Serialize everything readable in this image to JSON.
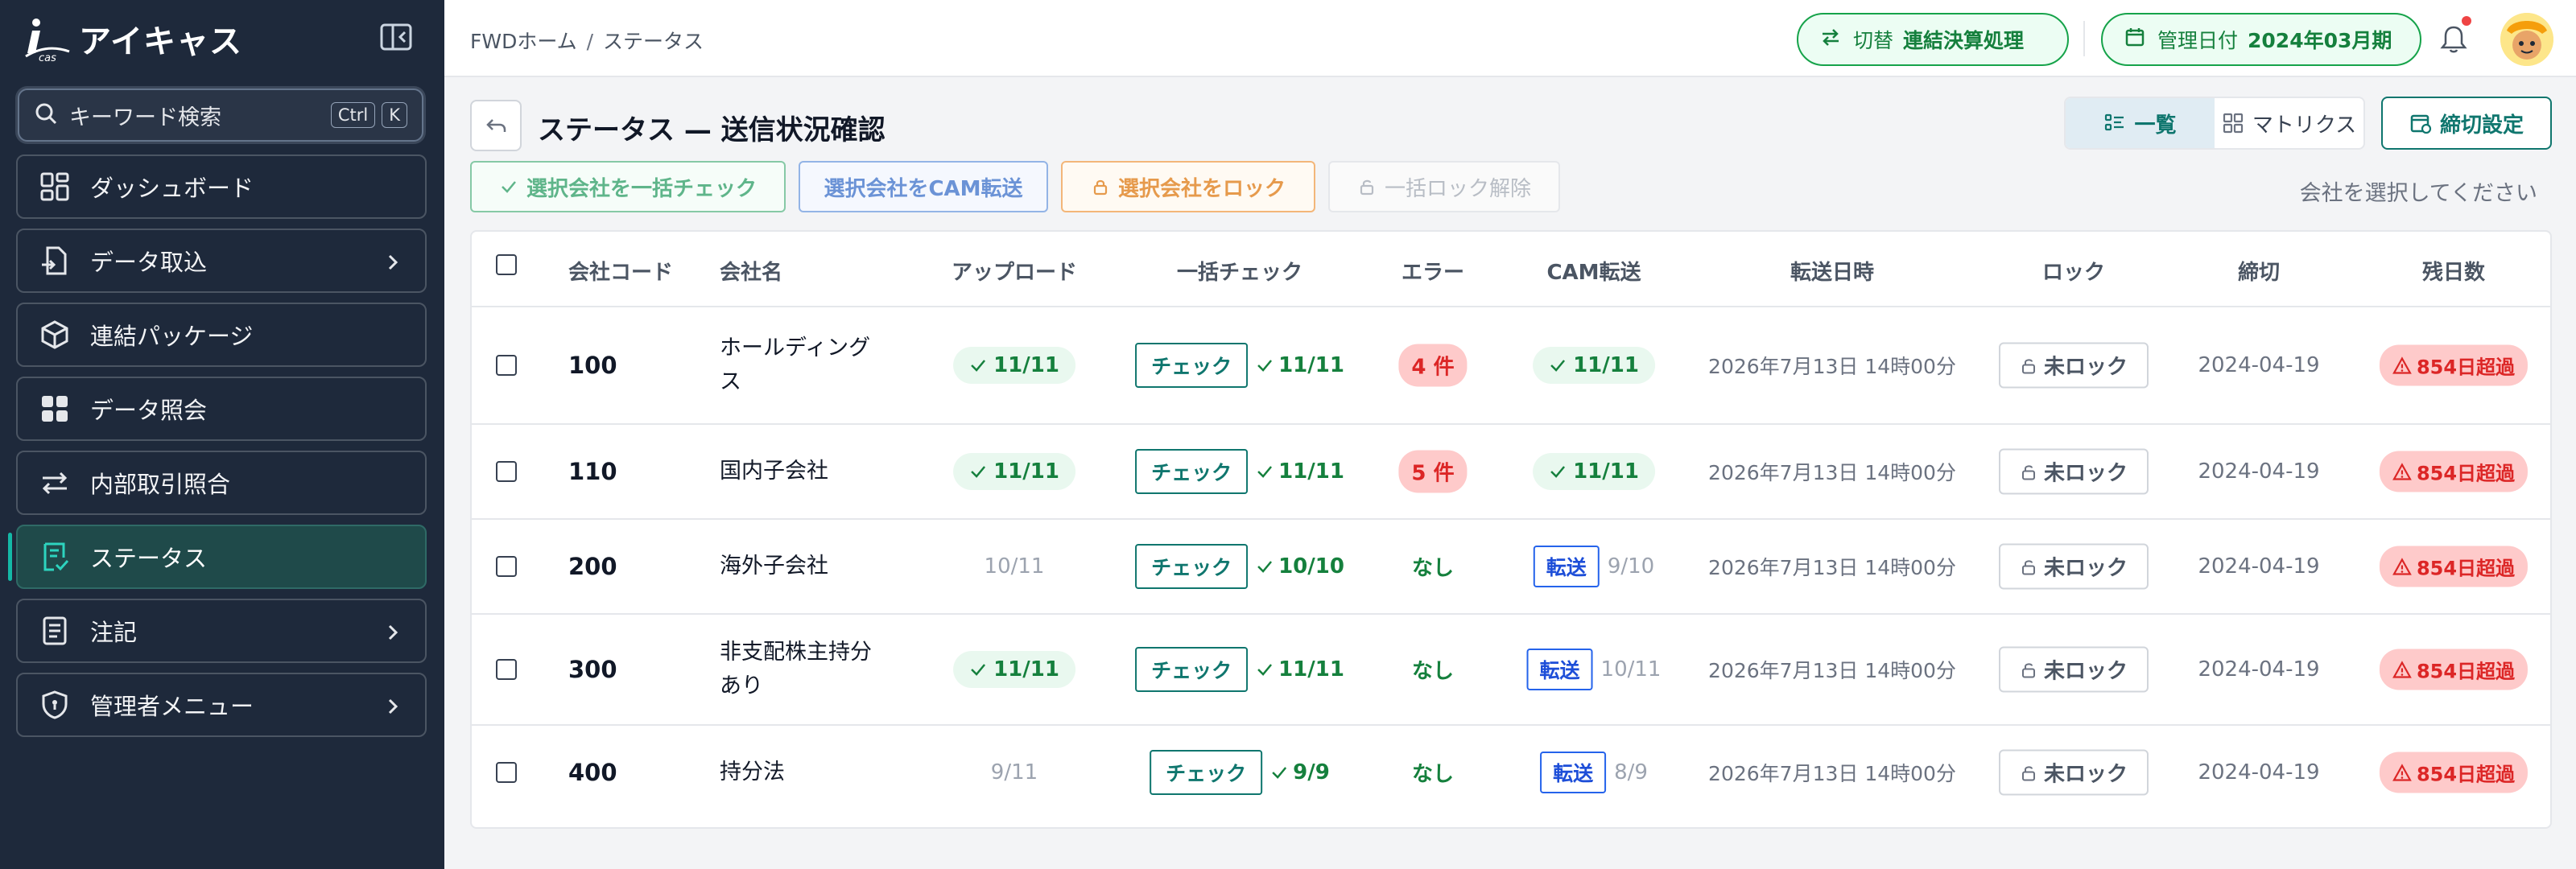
{
  "app": {
    "logo_text": "アイキャス"
  },
  "search": {
    "placeholder": "キーワード検索",
    "kbd1": "Ctrl",
    "kbd2": "K"
  },
  "sidebar": {
    "items": [
      {
        "label": "ダッシュボード",
        "icon": "dashboard-icon",
        "chevron": false,
        "active": false
      },
      {
        "label": "データ取込",
        "icon": "file-import-icon",
        "chevron": true,
        "active": false
      },
      {
        "label": "連結パッケージ",
        "icon": "package-icon",
        "chevron": false,
        "active": false
      },
      {
        "label": "データ照会",
        "icon": "grid-icon",
        "chevron": false,
        "active": false
      },
      {
        "label": "内部取引照合",
        "icon": "swap-arrows-icon",
        "chevron": false,
        "active": false
      },
      {
        "label": "ステータス",
        "icon": "status-doc-icon",
        "chevron": false,
        "active": true
      },
      {
        "label": "注記",
        "icon": "notes-icon",
        "chevron": true,
        "active": false
      },
      {
        "label": "管理者メニュー",
        "icon": "shield-icon",
        "chevron": true,
        "active": false
      }
    ]
  },
  "header": {
    "breadcrumb": [
      "FWDホーム",
      "ステータス"
    ],
    "breadcrumb_sep": "/",
    "switch_label": "切替",
    "switch_value": "連結決算処理",
    "date_label": "管理日付",
    "date_value": "2024年03月期"
  },
  "page": {
    "title": "ステータス — 送信状況確認",
    "view_list": "一覧",
    "view_matrix": "マトリクス",
    "close_settings": "締切設定",
    "actions": {
      "bulk_check": "選択会社を一括チェック",
      "cam_transfer": "選択会社をCAM転送",
      "lock": "選択会社をロック",
      "unlock": "一括ロック解除"
    },
    "hint": "会社を選択してください"
  },
  "table": {
    "headers": [
      "会社コード",
      "会社名",
      "アップロード",
      "一括チェック",
      "エラー",
      "CAM転送",
      "転送日時",
      "ロック",
      "締切",
      "残日数"
    ],
    "check_btn": "チェック",
    "transfer_btn": "転送",
    "rows": [
      {
        "code": "100",
        "name": "ホールディングス",
        "upload": "11/11",
        "upload_ok": true,
        "check": "11/11",
        "error": "4 件",
        "error_flag": true,
        "cam": "11/11",
        "cam_ok": true,
        "datetime": "2026年7月13日 14時00分",
        "lock": "未ロック",
        "due": "2024-04-19",
        "remaining": "854日超過"
      },
      {
        "code": "110",
        "name": "国内子会社",
        "upload": "11/11",
        "upload_ok": true,
        "check": "11/11",
        "error": "5 件",
        "error_flag": true,
        "cam": "11/11",
        "cam_ok": true,
        "datetime": "2026年7月13日 14時00分",
        "lock": "未ロック",
        "due": "2024-04-19",
        "remaining": "854日超過"
      },
      {
        "code": "200",
        "name": "海外子会社",
        "upload": "10/11",
        "upload_ok": false,
        "check": "10/10",
        "error": "なし",
        "error_flag": false,
        "cam": "9/10",
        "cam_ok": false,
        "datetime": "2026年7月13日 14時00分",
        "lock": "未ロック",
        "due": "2024-04-19",
        "remaining": "854日超過"
      },
      {
        "code": "300",
        "name": "非支配株主持分あり",
        "upload": "11/11",
        "upload_ok": true,
        "check": "11/11",
        "error": "なし",
        "error_flag": false,
        "cam": "10/11",
        "cam_ok": false,
        "datetime": "2026年7月13日 14時00分",
        "lock": "未ロック",
        "due": "2024-04-19",
        "remaining": "854日超過"
      },
      {
        "code": "400",
        "name": "持分法",
        "upload": "9/11",
        "upload_ok": false,
        "check": "9/9",
        "error": "なし",
        "error_flag": false,
        "cam": "8/9",
        "cam_ok": false,
        "datetime": "2026年7月13日 14時00分",
        "lock": "未ロック",
        "due": "2024-04-19",
        "remaining": "854日超過"
      }
    ]
  },
  "colors": {
    "sidebar_bg": "#1e293b",
    "accent": "#0f766e",
    "success": "#15803d",
    "danger": "#dc2626",
    "link_blue": "#1d4ed8"
  }
}
